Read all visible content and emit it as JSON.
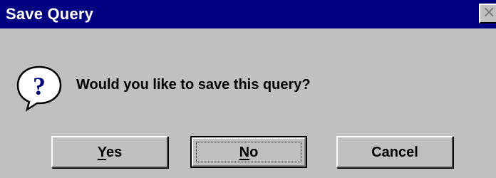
{
  "window": {
    "title": "Save Query",
    "close_glyph": "✕"
  },
  "message": {
    "icon": "question-icon",
    "text": "Would you like to save this query?"
  },
  "buttons": {
    "yes": {
      "mnemonic": "Y",
      "rest": "es"
    },
    "no": {
      "mnemonic": "N",
      "rest": "o",
      "focused": true
    },
    "cancel": {
      "label": "Cancel"
    }
  },
  "colors": {
    "titlebar": "#000080",
    "dialog": "#c0c0c0",
    "icon_bubble": "#ffffff",
    "icon_mark": "#000080"
  }
}
